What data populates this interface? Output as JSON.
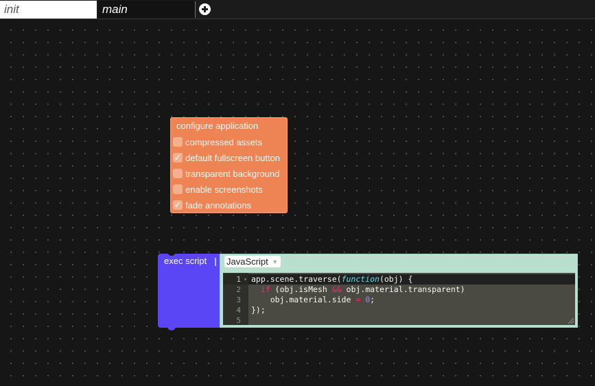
{
  "tabs": [
    {
      "label": "init",
      "active": true
    },
    {
      "label": "main",
      "active": false
    }
  ],
  "add_tab_icon": "plus-circle-icon",
  "config_block": {
    "title": "configure application",
    "color": "#ee8453",
    "options": [
      {
        "label": "compressed assets",
        "checked": false,
        "mark": ""
      },
      {
        "label": "default fullscreen button",
        "checked": true,
        "mark": "✓"
      },
      {
        "label": "transparent background",
        "checked": false,
        "mark": ""
      },
      {
        "label": "enable screenshots",
        "checked": false,
        "mark": ""
      },
      {
        "label": "fade annotations",
        "checked": true,
        "mark": "✓"
      }
    ]
  },
  "exec_block": {
    "title": "exec script",
    "color": "#5a46f5",
    "language": "JavaScript",
    "code_lines": [
      {
        "num": "1",
        "text": "app.scene.traverse(function(obj) {"
      },
      {
        "num": "2",
        "text": "  if (obj.isMesh && obj.material.transparent)"
      },
      {
        "num": "3",
        "text": "    obj.material.side = 0;"
      },
      {
        "num": "4",
        "text": "});"
      },
      {
        "num": "5",
        "text": ""
      }
    ]
  }
}
